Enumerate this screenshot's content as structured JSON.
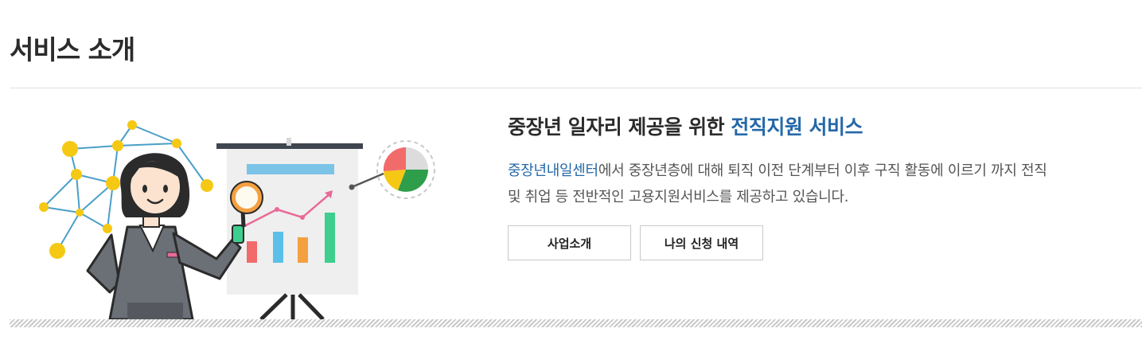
{
  "page": {
    "title": "서비스 소개"
  },
  "intro": {
    "headline_prefix": "중장년 일자리 제공을 위한 ",
    "headline_accent": "전직지원 서비스",
    "desc_link": "중장년내일센터",
    "desc_line1_rest": "에서 중장년층에 대해 퇴직 이전 단계부터 이후 구직 활동에 이르기 까지 전직",
    "desc_line2": "및 취업 등 전반적인 고용지원서비스를 제공하고 있습니다."
  },
  "buttons": {
    "business_intro": "사업소개",
    "my_applications": "나의 신청 내역"
  },
  "colors": {
    "accent": "#2468a8",
    "network_node": "#f5c814",
    "network_line": "#4a9fc8",
    "bar_red": "#f26b6b",
    "bar_blue": "#5bc0e8",
    "bar_orange": "#f5a040",
    "bar_green": "#3ecf8e"
  },
  "icons": [
    "network-icon",
    "magnifier-icon",
    "pie-chart-icon",
    "trend-line-icon"
  ]
}
